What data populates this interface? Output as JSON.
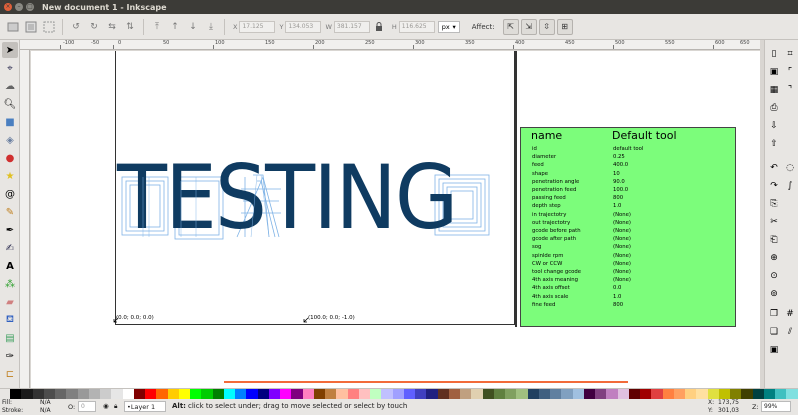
{
  "window": {
    "title": "New document 1 - Inkscape",
    "close_glyph": "×",
    "min_glyph": "–",
    "max_glyph": "□"
  },
  "toolbar": {
    "x_label": "X",
    "x_value": "17.125",
    "y_label": "Y",
    "y_value": "134.053",
    "w_label": "W",
    "w_value": "381.157",
    "h_label": "H",
    "h_value": "116.625",
    "unit": "px",
    "affect_label": "Affect:"
  },
  "ruler": {
    "labels": [
      "-100",
      "-50",
      "0",
      "50",
      "100",
      "150",
      "200",
      "250",
      "300",
      "350",
      "400",
      "450",
      "500",
      "550",
      "600",
      "650",
      "700",
      "750"
    ]
  },
  "canvas": {
    "text": "TESTING",
    "coord_origin": "(0.0; 0.0; 0.0)",
    "coord_end": "(100.0; 0.0; -1.0)"
  },
  "tool_table": {
    "header_name": "name",
    "header_value": "Default tool",
    "bg_color": "#7cfd7b",
    "rows": [
      {
        "k": "id",
        "v": "default tool"
      },
      {
        "k": "diameter",
        "v": "0.25"
      },
      {
        "k": "feed",
        "v": "400.0"
      },
      {
        "k": "shape",
        "v": "10"
      },
      {
        "k": "penetration angle",
        "v": "90.0"
      },
      {
        "k": "penetration feed",
        "v": "100.0"
      },
      {
        "k": "passing feed",
        "v": "800"
      },
      {
        "k": "depth step",
        "v": "1.0"
      },
      {
        "k": "in trajectotry",
        "v": "(None)"
      },
      {
        "k": "out trajectotry",
        "v": "(None)"
      },
      {
        "k": "gcode before path",
        "v": "(None)"
      },
      {
        "k": "gcode after path",
        "v": "(None)"
      },
      {
        "k": "sog",
        "v": "(None)"
      },
      {
        "k": "spinlde rpm",
        "v": "(None)"
      },
      {
        "k": "CW or CCW",
        "v": "(None)"
      },
      {
        "k": "tool change gcode",
        "v": "(None)"
      },
      {
        "k": "4th axis meaning",
        "v": "(None)"
      },
      {
        "k": "4th axis offset",
        "v": "0.0"
      },
      {
        "k": "4th axis scale",
        "v": "1.0"
      },
      {
        "k": "fine feed",
        "v": "800"
      }
    ]
  },
  "status": {
    "fill_label": "Fill:",
    "fill_value": "N/A",
    "stroke_label": "Stroke:",
    "stroke_value": "N/A",
    "opacity_label": "O:",
    "opacity_value": "0",
    "layer": "•Layer 1",
    "message_bold": "Alt:",
    "message": " click to select under; drag to move selected or select by touch",
    "x_label": "X:",
    "x_value": "173,75",
    "y_label": "Y:",
    "y_value": "301,03",
    "zoom_label": "Z:",
    "zoom_value": "99%"
  },
  "palette": [
    "#000000",
    "#1a1a1a",
    "#333333",
    "#4d4d4d",
    "#666666",
    "#808080",
    "#999999",
    "#b3b3b3",
    "#cccccc",
    "#e6e6e6",
    "#ffffff",
    "#800000",
    "#ff0000",
    "#ff6600",
    "#ffcc00",
    "#ffff00",
    "#00ff00",
    "#00cc00",
    "#008000",
    "#00ffff",
    "#0080ff",
    "#0000ff",
    "#000080",
    "#8000ff",
    "#ff00ff",
    "#800080",
    "#ff80c0",
    "#804000",
    "#c08040",
    "#ffc0a0",
    "#ff8080",
    "#ffc0c0",
    "#c0ffc0",
    "#c0c0ff",
    "#a0a0ff",
    "#6060ff",
    "#4040c0",
    "#202080",
    "#603020",
    "#a06040",
    "#c0a080",
    "#e0d0b0",
    "#405020",
    "#608040",
    "#80a060",
    "#a0c080",
    "#204060",
    "#406080",
    "#6080a0",
    "#80a0c0",
    "#a0c0e0",
    "#400040",
    "#804080",
    "#c080c0",
    "#e0c0e0",
    "#600000",
    "#a00000",
    "#e04040",
    "#ff8040",
    "#ffa060",
    "#ffd080",
    "#ffe0a0",
    "#e0e040",
    "#c0c000",
    "#808000",
    "#404000",
    "#004040",
    "#008080",
    "#40c0c0",
    "#80e0e0"
  ]
}
